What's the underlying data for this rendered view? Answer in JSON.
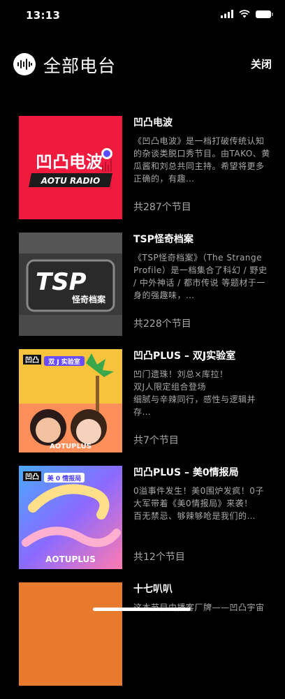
{
  "status_bar": {
    "time": "13:13"
  },
  "header": {
    "title": "全部电台",
    "close_label": "关闭"
  },
  "stations": [
    {
      "title": "凹凸电波",
      "description": "《凹凸电波》是一档打破传统认知的杂谈类脱口秀节目。由TAKO、黄瓜酱和刘总共同主持。希望将更多正确的，有趣…",
      "count": "共287个节目",
      "cover_text": "凹凸电波",
      "cover_subtext": "AOTU RADIO",
      "cover_color": "#f0193e"
    },
    {
      "title": "TSP怪奇档案",
      "description": "《TSP怪奇档案》（The Strange Profile）是一档集合了科幻 / 野史 / 中外神话 / 都市传说 等题材于一身的强趣味，…",
      "count": "共228个节目",
      "cover_text": "TSP",
      "cover_subtext": "怪奇档案",
      "cover_color": "#3a3a3a"
    },
    {
      "title": "凹凸PLUS – 双J实验室",
      "description": "凹门遗珠！刘总×库拉！\n双J人限定组合登场\n细腻与辛辣同行，感性与逻辑并存…",
      "count": "共7个节目",
      "cover_text": "凹凸",
      "cover_subtext": "双 J 实验室",
      "cover_brand": "AOTUPLUS",
      "cover_color": "#f7c23c"
    },
    {
      "title": "凹凸PLUS – 美0情报局",
      "description": "0溢事件发生！美0围炉发疯！0子大军带着《美0情报局》来袭！\n百无禁忌、够辣够呛是我们的…",
      "count": "共12个节目",
      "cover_text": "凹凸",
      "cover_subtext": "美 0 情报局",
      "cover_brand": "AOTUPLUS",
      "cover_color": "#6a5acd"
    },
    {
      "title": "十七叭叭",
      "description": "这本节目由播客厂牌——凹凸宇宙",
      "count": "",
      "cover_color": "#e87a2e"
    }
  ]
}
